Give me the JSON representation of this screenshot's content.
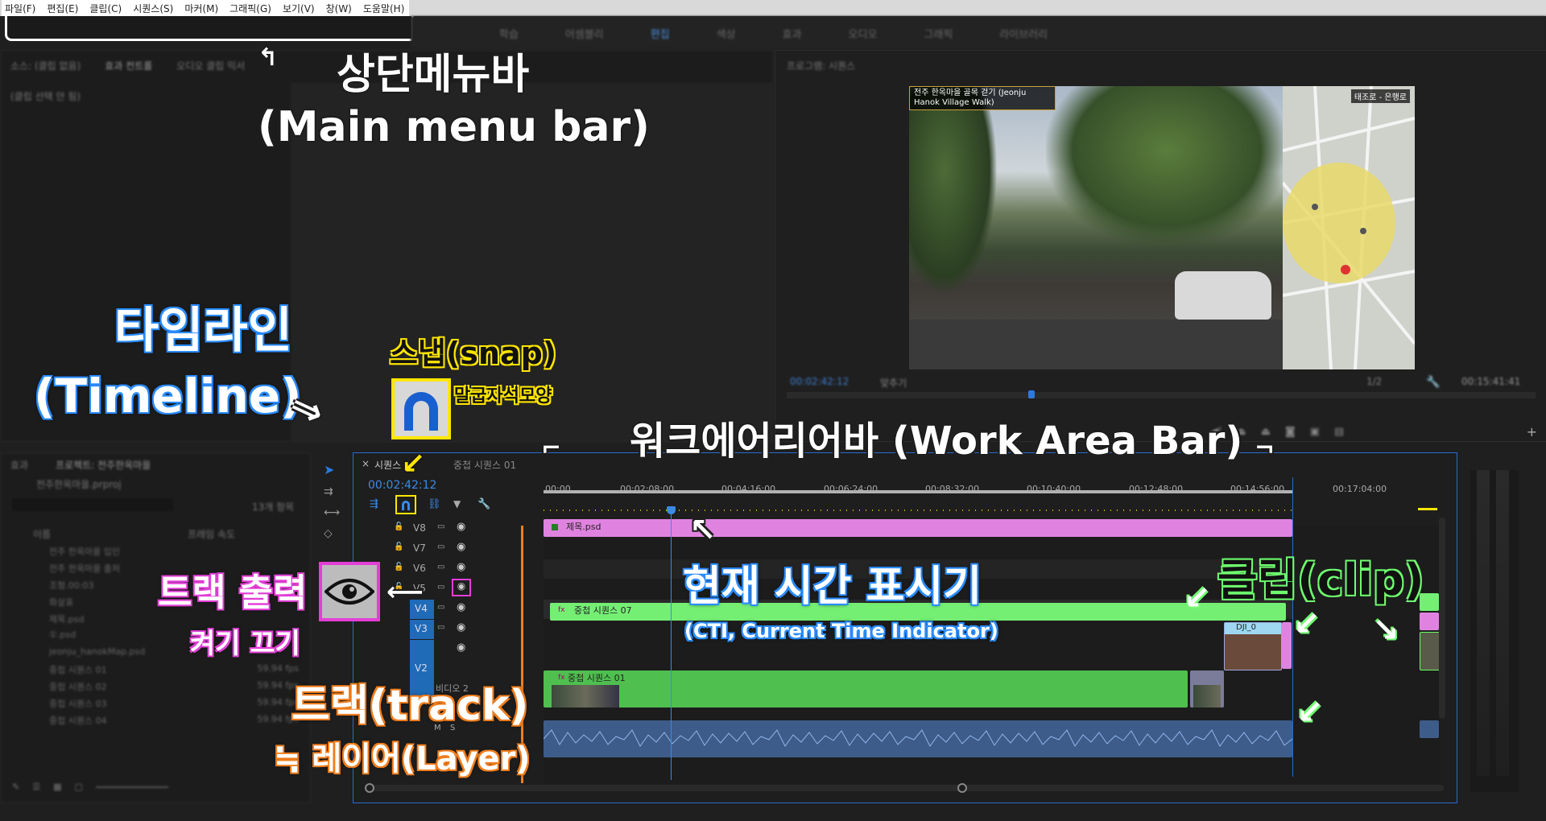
{
  "menu": {
    "items": [
      "파일(F)",
      "편집(E)",
      "클립(C)",
      "시퀀스(S)",
      "마커(M)",
      "그래픽(G)",
      "보기(V)",
      "창(W)",
      "도움말(H)"
    ]
  },
  "workspace_tabs": [
    "학습",
    "어셈블리",
    "편집",
    "색상",
    "효과",
    "오디오",
    "그래픽",
    "라이브러리"
  ],
  "source_panel": {
    "tabs": [
      "소스: (클립 없음)",
      "효과 컨트롤",
      "오디오 클립 믹서"
    ],
    "empty_text": "(클립 선택 안 됨)"
  },
  "program_monitor": {
    "title": "프로그램: 시퀀스",
    "timecode": "00:02:42:12",
    "fit": "맞추기",
    "scale": "1/2",
    "duration": "00:15:41:41",
    "overlay_title": "전주 한옥마을 골목 걷기 (Jeonju Hanok Village Walk)",
    "map_caption": "태조로 - 은행로"
  },
  "project_panel": {
    "tabs": [
      "효과",
      "프로젝트: 전주한옥마을"
    ],
    "project_file": "전주한옥마을.prproj",
    "item_count": "13개 항목",
    "columns": [
      "이름",
      "프레임 속도"
    ],
    "items": [
      {
        "name": "전주 한옥마을 입인",
        "rate": ""
      },
      {
        "name": "전주 한옥마을 출처",
        "rate": ""
      },
      {
        "name": "조형.00:03",
        "rate": ""
      },
      {
        "name": "화살표",
        "rate": ""
      },
      {
        "name": "제목.psd",
        "rate": ""
      },
      {
        "name": "①.psd",
        "rate": ""
      },
      {
        "name": "jeonju_hanokMap.psd",
        "rate": ""
      },
      {
        "name": "중첩 시퀀스 01",
        "rate": "59.94 fps"
      },
      {
        "name": "중첩 시퀀스 02",
        "rate": "59.94 fps"
      },
      {
        "name": "중첩 시퀀스 03",
        "rate": "59.94 fps"
      },
      {
        "name": "중첩 시퀀스 04",
        "rate": "59.94 fps"
      }
    ]
  },
  "timeline": {
    "tabs": [
      "시퀀스",
      "중첩 시퀀스 01"
    ],
    "timecode": "00:02:42:12",
    "ruler": [
      "00:00",
      "00:02:08:00",
      "00:04:16:00",
      "00:06:24:00",
      "00:08:32:00",
      "00:10:40:00",
      "00:12:48:00",
      "00:14:56:00",
      "00:17:04:00"
    ],
    "tracks": [
      "V8",
      "V7",
      "V6",
      "V5",
      "V4",
      "V3",
      "V2"
    ],
    "video2_label": "비디오 2",
    "audio_labels": [
      "M",
      "S"
    ],
    "clips": {
      "title_psd": "제목.psd",
      "nested07": "중첩 시퀀스 07",
      "nested01": "중첩 시퀀스 01",
      "dji": "DJI_0"
    }
  },
  "annotations": {
    "menubar_kr": "상단메뉴바",
    "menubar_en": "(Main menu bar)",
    "timeline_kr": "타임라인",
    "timeline_en": "(Timeline)",
    "snap_title": "스냅(snap)",
    "snap_desc": "말굽자석모양",
    "work_area": "워크에어리어바 (Work Area Bar)",
    "cti_kr": "현재 시간 표시기",
    "cti_en": "(CTI, Current Time Indicator)",
    "clip": "클립(clip)",
    "track_output_kr": "트랙 출력",
    "track_output_sub": "켜기 끄기",
    "track_kr": "트랙(track)",
    "layer": "≒ 레이어(Layer)"
  },
  "colors": {
    "accent_blue": "#2a8cff",
    "clip_pink": "#e083e0",
    "clip_green": "#5fe05f",
    "clip_green_dark": "#4fbf4f",
    "annotation_yellow": "#ffe600",
    "annotation_magenta": "#e23fd6",
    "annotation_green": "#6fff6f",
    "annotation_orange": "#f07d1c"
  }
}
